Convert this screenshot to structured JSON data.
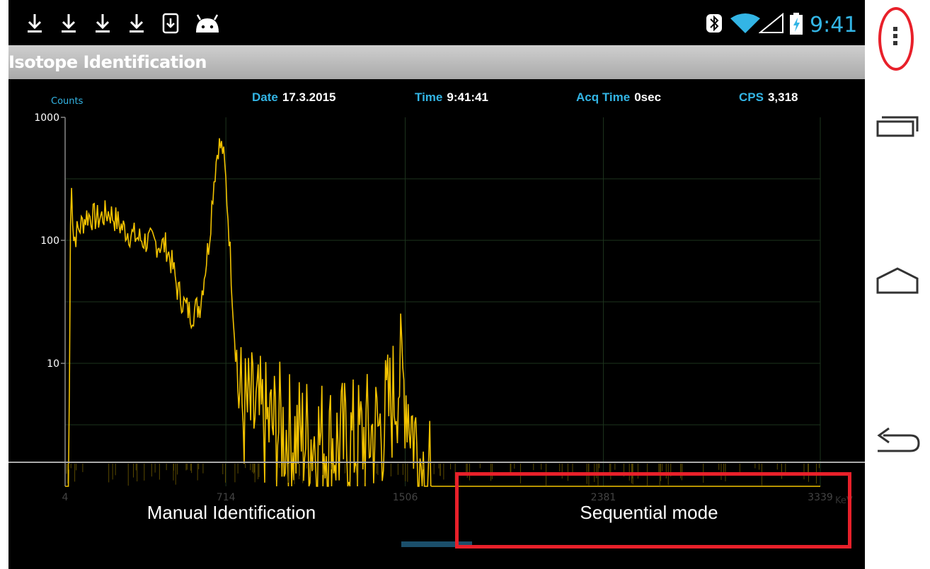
{
  "statusbar": {
    "clock": "9:41",
    "left_icons": [
      "download-icon",
      "download-icon",
      "download-icon",
      "download-icon",
      "download-box-icon",
      "android-icon"
    ],
    "right_icons": [
      "bluetooth-icon",
      "wifi-icon",
      "cell-signal-icon",
      "battery-charging-icon"
    ],
    "accent": "#33b5e5"
  },
  "actionbar": {
    "title": "Isotope Identification"
  },
  "info": {
    "date_label": "Date",
    "date_value": "17.3.2015",
    "time_label": "Time",
    "time_value": "9:41:41",
    "acq_label": "Acq Time",
    "acq_value": "0sec",
    "cps_label": "CPS",
    "cps_value": "3,318"
  },
  "chart_data": {
    "type": "line",
    "ylabel": "Counts",
    "xlabel": "KeV",
    "yscale": "log",
    "ylim": [
      1,
      1000
    ],
    "xlim": [
      4,
      3339
    ],
    "y_ticks": [
      "1000",
      "100",
      "10"
    ],
    "x_ticks": [
      "4",
      "714",
      "1506",
      "2381",
      "3339"
    ],
    "x_tick_values": [
      4,
      714,
      1506,
      2381,
      3339
    ],
    "grid": true,
    "line_color": "#f2c200",
    "series": [
      {
        "x": [
          4,
          20,
          30,
          40,
          60,
          100,
          150,
          200,
          250,
          300,
          350,
          400,
          450,
          480,
          500,
          530,
          560,
          600,
          640,
          660,
          680,
          700,
          714,
          730,
          750,
          770,
          790,
          810,
          850,
          900,
          950,
          1000,
          1100,
          1200,
          1300,
          1400,
          1450,
          1480,
          1510,
          1540,
          1580,
          1620,
          1650,
          1680,
          1720,
          1800,
          2000,
          2200,
          2400,
          2600,
          2800,
          3000,
          3200,
          3339
        ],
        "y": [
          1,
          1,
          500,
          100,
          120,
          160,
          150,
          170,
          130,
          110,
          100,
          95,
          90,
          60,
          40,
          30,
          25,
          30,
          100,
          300,
          600,
          550,
          300,
          100,
          20,
          6,
          4,
          4,
          3.5,
          3,
          3,
          2.5,
          2.5,
          2.2,
          2.3,
          3,
          5,
          8,
          6,
          3,
          1.5,
          1,
          1,
          1,
          1,
          1,
          1,
          1,
          1,
          1,
          1,
          1,
          1,
          1
        ]
      }
    ]
  },
  "buttons": {
    "manual": "Manual Identification",
    "sequential": "Sequential mode"
  },
  "navbar": {
    "items": [
      "overflow-menu-icon",
      "recent-apps-icon",
      "home-icon",
      "back-icon"
    ]
  },
  "highlight_color": "#e8202a"
}
